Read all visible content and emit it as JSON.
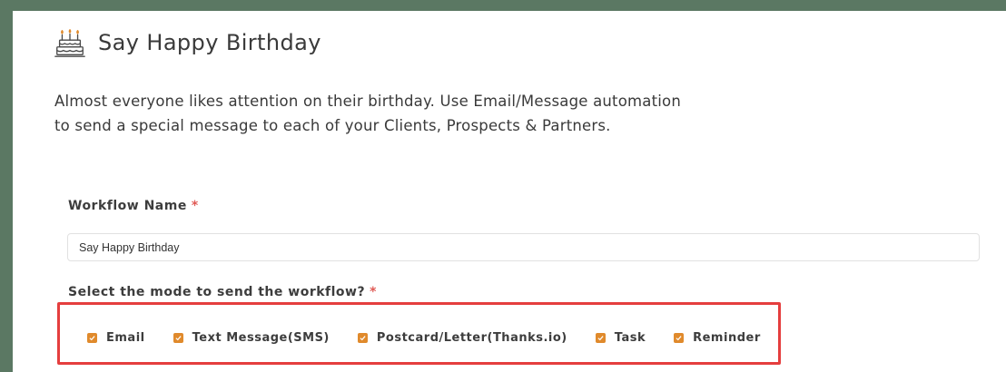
{
  "page": {
    "title": "Say Happy Birthday",
    "icon": "birthday-cake-icon",
    "description_lines": [
      "Almost everyone likes attention on their birthday. Use Email/Message automation",
      "to send a special message to each of your Clients, Prospects & Partners."
    ]
  },
  "form": {
    "workflow_name_label": "Workflow Name",
    "workflow_name_value": "Say Happy Birthday",
    "mode_label": "Select the mode to send the workflow?",
    "required_marker": "*",
    "modes": [
      {
        "label": "Email",
        "checked": true
      },
      {
        "label": "Text Message(SMS)",
        "checked": true
      },
      {
        "label": "Postcard/Letter(Thanks.io)",
        "checked": true
      },
      {
        "label": "Task",
        "checked": true
      },
      {
        "label": "Reminder",
        "checked": true
      }
    ]
  },
  "colors": {
    "background": "#5b7863",
    "checkbox": "#e08a2c",
    "required": "#e05a55",
    "highlight_border": "#e53e3e"
  }
}
